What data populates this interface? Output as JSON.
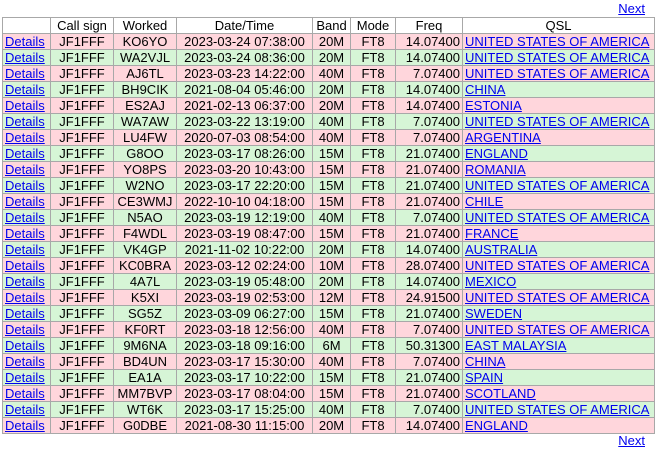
{
  "nav": {
    "next_label": "Next"
  },
  "headers": [
    "",
    "Call sign",
    "Worked",
    "Date/Time",
    "Band",
    "Mode",
    "Freq",
    "QSL"
  ],
  "details_label": "Details",
  "colors": {
    "pink": "#ffd6dc",
    "green": "#d6f5d6",
    "link": "#0000ee"
  },
  "rows": [
    {
      "call": "JF1FFF",
      "worked": "KO6YO",
      "datetime": "2023-03-24 07:38:00",
      "band": "20M",
      "mode": "FT8",
      "freq": "14.07400",
      "qsl": "UNITED STATES OF AMERICA",
      "color": "pink"
    },
    {
      "call": "JF1FFF",
      "worked": "WA2VJL",
      "datetime": "2023-03-24 08:36:00",
      "band": "20M",
      "mode": "FT8",
      "freq": "14.07400",
      "qsl": "UNITED STATES OF AMERICA",
      "color": "green"
    },
    {
      "call": "JF1FFF",
      "worked": "AJ6TL",
      "datetime": "2023-03-23 14:22:00",
      "band": "40M",
      "mode": "FT8",
      "freq": "7.07400",
      "qsl": "UNITED STATES OF AMERICA",
      "color": "pink"
    },
    {
      "call": "JF1FFF",
      "worked": "BH9CIK",
      "datetime": "2021-08-04 05:46:00",
      "band": "20M",
      "mode": "FT8",
      "freq": "14.07400",
      "qsl": "CHINA",
      "color": "green"
    },
    {
      "call": "JF1FFF",
      "worked": "ES2AJ",
      "datetime": "2021-02-13 06:37:00",
      "band": "20M",
      "mode": "FT8",
      "freq": "14.07400",
      "qsl": "ESTONIA",
      "color": "pink"
    },
    {
      "call": "JF1FFF",
      "worked": "WA7AW",
      "datetime": "2023-03-22 13:19:00",
      "band": "40M",
      "mode": "FT8",
      "freq": "7.07400",
      "qsl": "UNITED STATES OF AMERICA",
      "color": "green"
    },
    {
      "call": "JF1FFF",
      "worked": "LU4FW",
      "datetime": "2020-07-03 08:54:00",
      "band": "40M",
      "mode": "FT8",
      "freq": "7.07400",
      "qsl": "ARGENTINA",
      "color": "pink"
    },
    {
      "call": "JF1FFF",
      "worked": "G8OO",
      "datetime": "2023-03-17 08:26:00",
      "band": "15M",
      "mode": "FT8",
      "freq": "21.07400",
      "qsl": "ENGLAND",
      "color": "green"
    },
    {
      "call": "JF1FFF",
      "worked": "YO8PS",
      "datetime": "2023-03-20 10:43:00",
      "band": "15M",
      "mode": "FT8",
      "freq": "21.07400",
      "qsl": "ROMANIA",
      "color": "pink"
    },
    {
      "call": "JF1FFF",
      "worked": "W2NO",
      "datetime": "2023-03-17 22:20:00",
      "band": "15M",
      "mode": "FT8",
      "freq": "21.07400",
      "qsl": "UNITED STATES OF AMERICA",
      "color": "green"
    },
    {
      "call": "JF1FFF",
      "worked": "CE3WMJ",
      "datetime": "2022-10-10 04:18:00",
      "band": "15M",
      "mode": "FT8",
      "freq": "21.07400",
      "qsl": "CHILE",
      "color": "pink"
    },
    {
      "call": "JF1FFF",
      "worked": "N5AO",
      "datetime": "2023-03-19 12:19:00",
      "band": "40M",
      "mode": "FT8",
      "freq": "7.07400",
      "qsl": "UNITED STATES OF AMERICA",
      "color": "green"
    },
    {
      "call": "JF1FFF",
      "worked": "F4WDL",
      "datetime": "2023-03-19 08:47:00",
      "band": "15M",
      "mode": "FT8",
      "freq": "21.07400",
      "qsl": "FRANCE",
      "color": "pink"
    },
    {
      "call": "JF1FFF",
      "worked": "VK4GP",
      "datetime": "2021-11-02 10:22:00",
      "band": "20M",
      "mode": "FT8",
      "freq": "14.07400",
      "qsl": "AUSTRALIA",
      "color": "green"
    },
    {
      "call": "JF1FFF",
      "worked": "KC0BRA",
      "datetime": "2023-03-12 02:24:00",
      "band": "10M",
      "mode": "FT8",
      "freq": "28.07400",
      "qsl": "UNITED STATES OF AMERICA",
      "color": "pink"
    },
    {
      "call": "JF1FFF",
      "worked": "4A7L",
      "datetime": "2023-03-19 05:48:00",
      "band": "20M",
      "mode": "FT8",
      "freq": "14.07400",
      "qsl": "MEXICO",
      "color": "green"
    },
    {
      "call": "JF1FFF",
      "worked": "K5XI",
      "datetime": "2023-03-19 02:53:00",
      "band": "12M",
      "mode": "FT8",
      "freq": "24.91500",
      "qsl": "UNITED STATES OF AMERICA",
      "color": "pink"
    },
    {
      "call": "JF1FFF",
      "worked": "SG5Z",
      "datetime": "2023-03-09 06:27:00",
      "band": "15M",
      "mode": "FT8",
      "freq": "21.07400",
      "qsl": "SWEDEN",
      "color": "green"
    },
    {
      "call": "JF1FFF",
      "worked": "KF0RT",
      "datetime": "2023-03-18 12:56:00",
      "band": "40M",
      "mode": "FT8",
      "freq": "7.07400",
      "qsl": "UNITED STATES OF AMERICA",
      "color": "pink"
    },
    {
      "call": "JF1FFF",
      "worked": "9M6NA",
      "datetime": "2023-03-18 09:16:00",
      "band": "6M",
      "mode": "FT8",
      "freq": "50.31300",
      "qsl": "EAST MALAYSIA",
      "color": "green"
    },
    {
      "call": "JF1FFF",
      "worked": "BD4UN",
      "datetime": "2023-03-17 15:30:00",
      "band": "40M",
      "mode": "FT8",
      "freq": "7.07400",
      "qsl": "CHINA",
      "color": "pink"
    },
    {
      "call": "JF1FFF",
      "worked": "EA1A",
      "datetime": "2023-03-17 10:22:00",
      "band": "15M",
      "mode": "FT8",
      "freq": "21.07400",
      "qsl": "SPAIN",
      "color": "green"
    },
    {
      "call": "JF1FFF",
      "worked": "MM7BVP",
      "datetime": "2023-03-17 08:04:00",
      "band": "15M",
      "mode": "FT8",
      "freq": "21.07400",
      "qsl": "SCOTLAND",
      "color": "pink"
    },
    {
      "call": "JF1FFF",
      "worked": "WT6K",
      "datetime": "2023-03-17 15:25:00",
      "band": "40M",
      "mode": "FT8",
      "freq": "7.07400",
      "qsl": "UNITED STATES OF AMERICA",
      "color": "green"
    },
    {
      "call": "JF1FFF",
      "worked": "G0DBE",
      "datetime": "2021-08-30 11:15:00",
      "band": "20M",
      "mode": "FT8",
      "freq": "14.07400",
      "qsl": "ENGLAND",
      "color": "pink"
    }
  ]
}
